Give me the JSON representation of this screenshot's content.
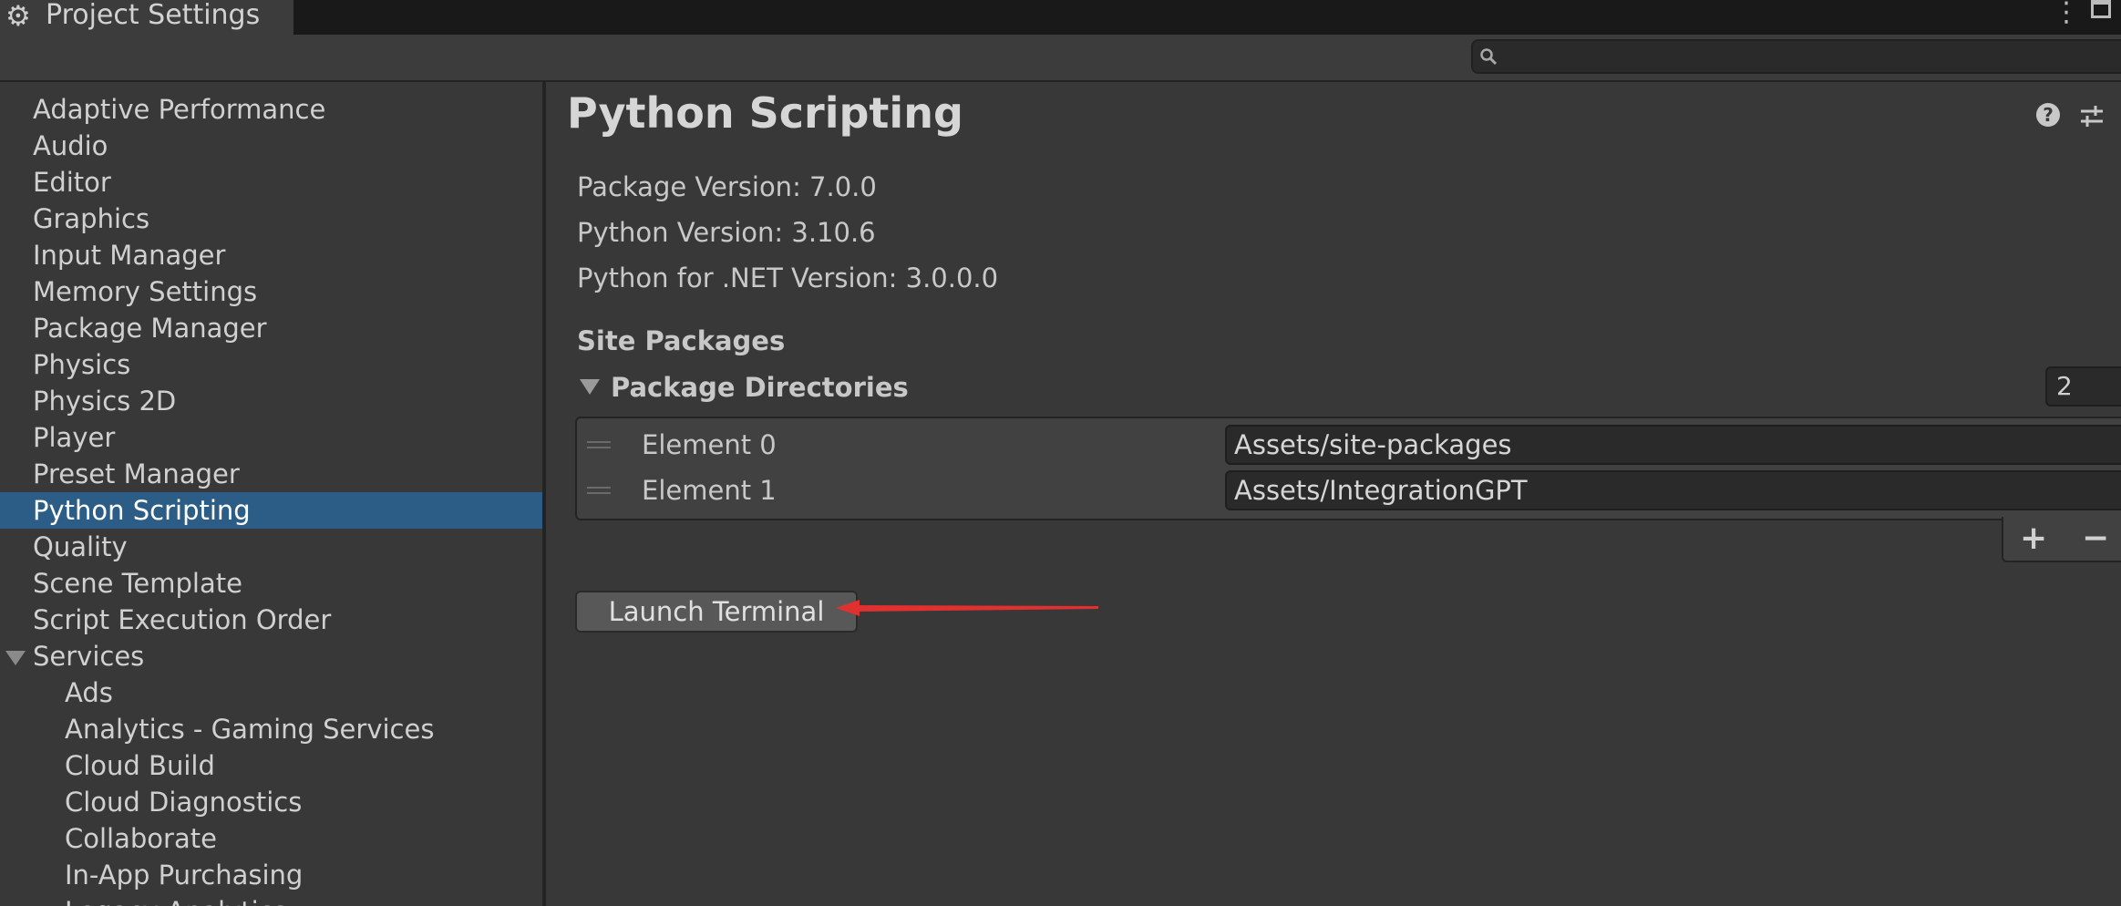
{
  "window": {
    "tab_title": "Project Settings",
    "tab_icon": "gear-icon",
    "menu_icon": "kebab-menu-icon",
    "maximize_icon": "maximize-icon"
  },
  "toolbar": {
    "search_value": "",
    "search_icon": "search-icon"
  },
  "sidebar": {
    "selected": "Python Scripting",
    "selected_color": "#2c5d87",
    "items": [
      {
        "label": "Adaptive Performance"
      },
      {
        "label": "Audio"
      },
      {
        "label": "Editor"
      },
      {
        "label": "Graphics"
      },
      {
        "label": "Input Manager"
      },
      {
        "label": "Memory Settings"
      },
      {
        "label": "Package Manager"
      },
      {
        "label": "Physics"
      },
      {
        "label": "Physics 2D"
      },
      {
        "label": "Player"
      },
      {
        "label": "Preset Manager"
      },
      {
        "label": "Python Scripting"
      },
      {
        "label": "Quality"
      },
      {
        "label": "Scene Template"
      },
      {
        "label": "Script Execution Order"
      },
      {
        "label": "Services",
        "expanded": true
      },
      {
        "label": "Ads"
      },
      {
        "label": "Analytics - Gaming Services"
      },
      {
        "label": "Cloud Build"
      },
      {
        "label": "Cloud Diagnostics"
      },
      {
        "label": "Collaborate"
      },
      {
        "label": "In-App Purchasing"
      },
      {
        "label": "Legacy Analytics"
      }
    ]
  },
  "main": {
    "title": "Python Scripting",
    "help_icon": "help-icon",
    "settings_icon": "preset-settings-icon",
    "package_version": "Package Version: 7.0.0",
    "python_version": "Python Version: 3.10.6",
    "dotnet_version": "Python for .NET Version: 3.0.0.0",
    "site_packages_header": "Site Packages",
    "package_directories": {
      "label": "Package Directories",
      "expanded": true,
      "count": "2",
      "elements": [
        {
          "label": "Element 0",
          "value": "Assets/site-packages"
        },
        {
          "label": "Element 1",
          "value": "Assets/IntegrationGPT"
        }
      ],
      "add_label": "+",
      "remove_label": "−"
    },
    "launch_terminal_label": "Launch Terminal",
    "annotation_arrow_color": "#e03030"
  }
}
